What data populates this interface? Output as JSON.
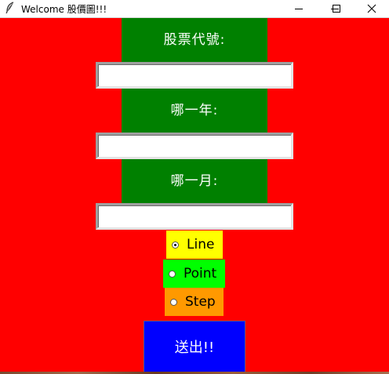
{
  "window": {
    "title": "Welcome 股價圖!!!",
    "icon": "feather-icon",
    "controls": [
      "minimize-icon",
      "maximize-icon",
      "close-icon"
    ]
  },
  "form": {
    "stock_label": "股票代號:",
    "stock_value": "",
    "year_label": "哪一年:",
    "year_value": "",
    "month_label": "哪一月:",
    "month_value": ""
  },
  "chart_type": {
    "options": [
      "Line",
      "Point",
      "Step"
    ],
    "selected": "Line"
  },
  "submit_label": "送出!!",
  "colors": {
    "background": "#ff0000",
    "label_bg": "#008000",
    "line_bg": "#ffff00",
    "point_bg": "#00ff00",
    "step_bg": "#ff9900",
    "submit_bg": "#0000ff"
  }
}
